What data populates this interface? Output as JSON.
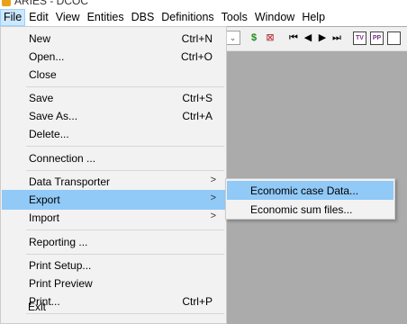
{
  "window": {
    "title": "ARIES - DCOC"
  },
  "menubar": [
    "File",
    "Edit",
    "View",
    "Entities",
    "DBS",
    "Definitions",
    "Tools",
    "Window",
    "Help"
  ],
  "file_menu": {
    "items": [
      {
        "label": "New",
        "shortcut": "Ctrl+N"
      },
      {
        "label": "Open...",
        "shortcut": "Ctrl+O"
      },
      {
        "label": "Close",
        "shortcut": ""
      },
      {
        "label": "Save",
        "shortcut": "Ctrl+S"
      },
      {
        "label": "Save As...",
        "shortcut": "Ctrl+A"
      },
      {
        "label": "Delete...",
        "shortcut": ""
      },
      {
        "label": "Connection ...",
        "shortcut": ""
      },
      {
        "label": "Data Transporter",
        "shortcut": ""
      },
      {
        "label": "Export",
        "shortcut": ""
      },
      {
        "label": "Import",
        "shortcut": ""
      },
      {
        "label": "Reporting ...",
        "shortcut": ""
      },
      {
        "label": "Print Setup...",
        "shortcut": ""
      },
      {
        "label": "Print Preview",
        "shortcut": ""
      },
      {
        "label": "Print...",
        "shortcut": "Ctrl+P"
      },
      {
        "label": "Exit",
        "shortcut": ""
      }
    ],
    "submenu_arrow": ">"
  },
  "export_submenu": {
    "items": [
      {
        "label": "Economic case Data..."
      },
      {
        "label": "Economic sum files..."
      }
    ]
  },
  "toolbar": {
    "combo_arrow": "⌄",
    "buttons": [
      "$",
      "⊠",
      "⏮",
      "◀",
      "▶",
      "⏭",
      "TV",
      "PP"
    ]
  }
}
